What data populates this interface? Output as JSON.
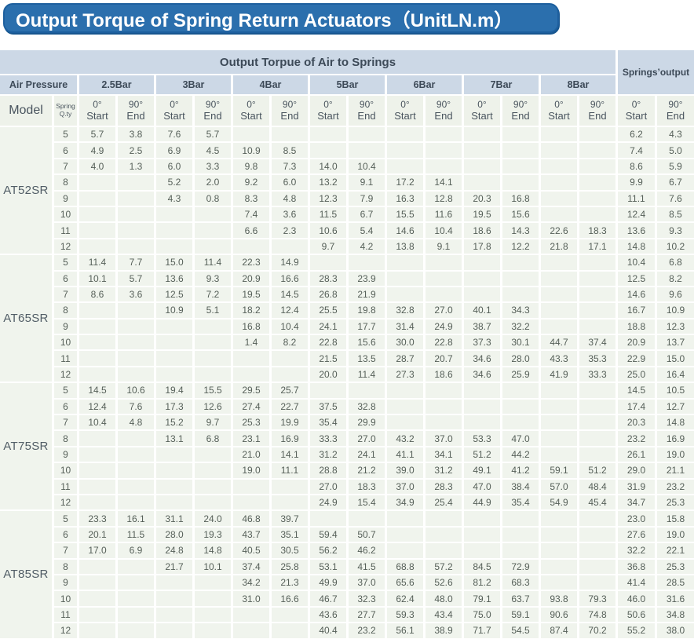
{
  "title": "Output Torque of Spring Return Actuators（UnitLN.m）",
  "colors": {
    "title_bar": "#2b6fad",
    "title_text": "#ffffff",
    "header_fill": "#ccd8e6",
    "subheader_fill": "#eef2ea",
    "cell_fill": "#f0f4ed",
    "header_text": "#3d4a58",
    "cell_text": "#555f58"
  },
  "table": {
    "air_header": "Output Torpue of Air to Springs",
    "springs_header": "Springs’output",
    "air_pressure_label": "Air Pressure",
    "model_label": "Model",
    "spring_label": "Spring",
    "qty_label": "Q.ty",
    "pressures": [
      "2.5Bar",
      "3Bar",
      "4Bar",
      "5Bar",
      "6Bar",
      "7Bar",
      "8Bar"
    ],
    "col_start": {
      "deg": "0°",
      "label": "Start"
    },
    "col_end": {
      "deg": "90°",
      "label": "End"
    },
    "models": [
      {
        "name": "AT52SR",
        "rows": [
          {
            "qty": "5",
            "v": [
              "5.7",
              "3.8",
              "7.6",
              "5.7",
              "",
              "",
              "",
              "",
              "",
              "",
              "",
              "",
              "",
              "",
              "6.2",
              "4.3"
            ]
          },
          {
            "qty": "6",
            "v": [
              "4.9",
              "2.5",
              "6.9",
              "4.5",
              "10.9",
              "8.5",
              "",
              "",
              "",
              "",
              "",
              "",
              "",
              "",
              "7.4",
              "5.0"
            ]
          },
          {
            "qty": "7",
            "v": [
              "4.0",
              "1.3",
              "6.0",
              "3.3",
              "9.8",
              "7.3",
              "14.0",
              "10.4",
              "",
              "",
              "",
              "",
              "",
              "",
              "8.6",
              "5.9"
            ]
          },
          {
            "qty": "8",
            "v": [
              "",
              "",
              "5.2",
              "2.0",
              "9.2",
              "6.0",
              "13.2",
              "9.1",
              "17.2",
              "14.1",
              "",
              "",
              "",
              "",
              "9.9",
              "6.7"
            ]
          },
          {
            "qty": "9",
            "v": [
              "",
              "",
              "4.3",
              "0.8",
              "8.3",
              "4.8",
              "12.3",
              "7.9",
              "16.3",
              "12.8",
              "20.3",
              "16.8",
              "",
              "",
              "11.1",
              "7.6"
            ]
          },
          {
            "qty": "10",
            "v": [
              "",
              "",
              "",
              "",
              "7.4",
              "3.6",
              "11.5",
              "6.7",
              "15.5",
              "11.6",
              "19.5",
              "15.6",
              "",
              "",
              "12.4",
              "8.5"
            ]
          },
          {
            "qty": "11",
            "v": [
              "",
              "",
              "",
              "",
              "6.6",
              "2.3",
              "10.6",
              "5.4",
              "14.6",
              "10.4",
              "18.6",
              "14.3",
              "22.6",
              "18.3",
              "13.6",
              "9.3"
            ]
          },
          {
            "qty": "12",
            "v": [
              "",
              "",
              "",
              "",
              "",
              "",
              "9.7",
              "4.2",
              "13.8",
              "9.1",
              "17.8",
              "12.2",
              "21.8",
              "17.1",
              "14.8",
              "10.2"
            ]
          }
        ]
      },
      {
        "name": "AT65SR",
        "rows": [
          {
            "qty": "5",
            "v": [
              "11.4",
              "7.7",
              "15.0",
              "11.4",
              "22.3",
              "14.9",
              "",
              "",
              "",
              "",
              "",
              "",
              "",
              "",
              "10.4",
              "6.8"
            ]
          },
          {
            "qty": "6",
            "v": [
              "10.1",
              "5.7",
              "13.6",
              "9.3",
              "20.9",
              "16.6",
              "28.3",
              "23.9",
              "",
              "",
              "",
              "",
              "",
              "",
              "12.5",
              "8.2"
            ]
          },
          {
            "qty": "7",
            "v": [
              "8.6",
              "3.6",
              "12.5",
              "7.2",
              "19.5",
              "14.5",
              "26.8",
              "21.9",
              "",
              "",
              "",
              "",
              "",
              "",
              "14.6",
              "9.6"
            ]
          },
          {
            "qty": "8",
            "v": [
              "",
              "",
              "10.9",
              "5.1",
              "18.2",
              "12.4",
              "25.5",
              "19.8",
              "32.8",
              "27.0",
              "40.1",
              "34.3",
              "",
              "",
              "16.7",
              "10.9"
            ]
          },
          {
            "qty": "9",
            "v": [
              "",
              "",
              "",
              "",
              "16.8",
              "10.4",
              "24.1",
              "17.7",
              "31.4",
              "24.9",
              "38.7",
              "32.2",
              "",
              "",
              "18.8",
              "12.3"
            ]
          },
          {
            "qty": "10",
            "v": [
              "",
              "",
              "",
              "",
              "1.4",
              "8.2",
              "22.8",
              "15.6",
              "30.0",
              "22.8",
              "37.3",
              "30.1",
              "44.7",
              "37.4",
              "20.9",
              "13.7"
            ]
          },
          {
            "qty": "11",
            "v": [
              "",
              "",
              "",
              "",
              "",
              "",
              "21.5",
              "13.5",
              "28.7",
              "20.7",
              "34.6",
              "28.0",
              "43.3",
              "35.3",
              "22.9",
              "15.0"
            ]
          },
          {
            "qty": "12",
            "v": [
              "",
              "",
              "",
              "",
              "",
              "",
              "20.0",
              "11.4",
              "27.3",
              "18.6",
              "34.6",
              "25.9",
              "41.9",
              "33.3",
              "25.0",
              "16.4"
            ]
          }
        ]
      },
      {
        "name": "AT75SR",
        "rows": [
          {
            "qty": "5",
            "v": [
              "14.5",
              "10.6",
              "19.4",
              "15.5",
              "29.5",
              "25.7",
              "",
              "",
              "",
              "",
              "",
              "",
              "",
              "",
              "14.5",
              "10.5"
            ]
          },
          {
            "qty": "6",
            "v": [
              "12.4",
              "7.6",
              "17.3",
              "12.6",
              "27.4",
              "22.7",
              "37.5",
              "32.8",
              "",
              "",
              "",
              "",
              "",
              "",
              "17.4",
              "12.7"
            ]
          },
          {
            "qty": "7",
            "v": [
              "10.4",
              "4.8",
              "15.2",
              "9.7",
              "25.3",
              "19.9",
              "35.4",
              "29.9",
              "",
              "",
              "",
              "",
              "",
              "",
              "20.3",
              "14.8"
            ]
          },
          {
            "qty": "8",
            "v": [
              "",
              "",
              "13.1",
              "6.8",
              "23.1",
              "16.9",
              "33.3",
              "27.0",
              "43.2",
              "37.0",
              "53.3",
              "47.0",
              "",
              "",
              "23.2",
              "16.9"
            ]
          },
          {
            "qty": "9",
            "v": [
              "",
              "",
              "",
              "",
              "21.0",
              "14.1",
              "31.2",
              "24.1",
              "41.1",
              "34.1",
              "51.2",
              "44.2",
              "",
              "",
              "26.1",
              "19.0"
            ]
          },
          {
            "qty": "10",
            "v": [
              "",
              "",
              "",
              "",
              "19.0",
              "11.1",
              "28.8",
              "21.2",
              "39.0",
              "31.2",
              "49.1",
              "41.2",
              "59.1",
              "51.2",
              "29.0",
              "21.1"
            ]
          },
          {
            "qty": "11",
            "v": [
              "",
              "",
              "",
              "",
              "",
              "",
              "27.0",
              "18.3",
              "37.0",
              "28.3",
              "47.0",
              "38.4",
              "57.0",
              "48.4",
              "31.9",
              "23.2"
            ]
          },
          {
            "qty": "12",
            "v": [
              "",
              "",
              "",
              "",
              "",
              "",
              "24.9",
              "15.4",
              "34.9",
              "25.4",
              "44.9",
              "35.4",
              "54.9",
              "45.4",
              "34.7",
              "25.3"
            ]
          }
        ]
      },
      {
        "name": "AT85SR",
        "rows": [
          {
            "qty": "5",
            "v": [
              "23.3",
              "16.1",
              "31.1",
              "24.0",
              "46.8",
              "39.7",
              "",
              "",
              "",
              "",
              "",
              "",
              "",
              "",
              "23.0",
              "15.8"
            ]
          },
          {
            "qty": "6",
            "v": [
              "20.1",
              "11.5",
              "28.0",
              "19.3",
              "43.7",
              "35.1",
              "59.4",
              "50.7",
              "",
              "",
              "",
              "",
              "",
              "",
              "27.6",
              "19.0"
            ]
          },
          {
            "qty": "7",
            "v": [
              "17.0",
              "6.9",
              "24.8",
              "14.8",
              "40.5",
              "30.5",
              "56.2",
              "46.2",
              "",
              "",
              "",
              "",
              "",
              "",
              "32.2",
              "22.1"
            ]
          },
          {
            "qty": "8",
            "v": [
              "",
              "",
              "21.7",
              "10.1",
              "37.4",
              "25.8",
              "53.1",
              "41.5",
              "68.8",
              "57.2",
              "84.5",
              "72.9",
              "",
              "",
              "36.8",
              "25.3"
            ]
          },
          {
            "qty": "9",
            "v": [
              "",
              "",
              "",
              "",
              "34.2",
              "21.3",
              "49.9",
              "37.0",
              "65.6",
              "52.6",
              "81.2",
              "68.3",
              "",
              "",
              "41.4",
              "28.5"
            ]
          },
          {
            "qty": "10",
            "v": [
              "",
              "",
              "",
              "",
              "31.0",
              "16.6",
              "46.7",
              "32.3",
              "62.4",
              "48.0",
              "79.1",
              "63.7",
              "93.8",
              "79.3",
              "46.0",
              "31.6"
            ]
          },
          {
            "qty": "11",
            "v": [
              "",
              "",
              "",
              "",
              "",
              "",
              "43.6",
              "27.7",
              "59.3",
              "43.4",
              "75.0",
              "59.1",
              "90.6",
              "74.8",
              "50.6",
              "34.8"
            ]
          },
          {
            "qty": "12",
            "v": [
              "",
              "",
              "",
              "",
              "",
              "",
              "40.4",
              "23.2",
              "56.1",
              "38.9",
              "71.7",
              "54.5",
              "87.4",
              "70.2",
              "55.2",
              "38.0"
            ]
          }
        ]
      }
    ]
  }
}
